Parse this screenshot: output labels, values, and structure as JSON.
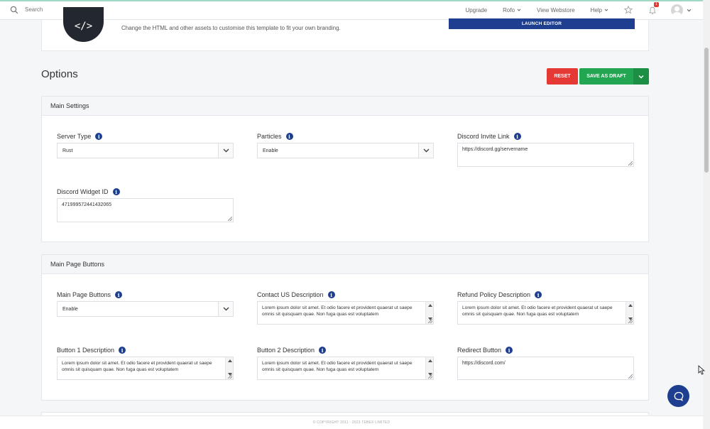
{
  "topnav": {
    "search_placeholder": "Search",
    "upgrade": "Upgrade",
    "account": "Rofo",
    "view_webstore": "View Webstore",
    "help": "Help",
    "notification_count": "1"
  },
  "editor": {
    "description": "Change the HTML and other assets to customise this template to fit your own branding.",
    "launch_label": "LAUNCH EDITOR",
    "logo_glyph": "</>"
  },
  "options": {
    "title": "Options",
    "reset_label": "RESET",
    "draft_label": "SAVE AS DRAFT"
  },
  "main_settings": {
    "heading": "Main Settings",
    "server_type": {
      "label": "Server Type",
      "value": "Rust"
    },
    "particles": {
      "label": "Particles",
      "value": "Enable"
    },
    "discord_invite": {
      "label": "Discord Invite Link",
      "value": "https://discord.gg/servername"
    },
    "discord_widget": {
      "label": "Discord Widget ID",
      "value": "471999572441432065"
    }
  },
  "main_page_buttons": {
    "heading": "Main Page Buttons",
    "buttons": {
      "label": "Main Page Buttons",
      "value": "Enable"
    },
    "contact_us": {
      "label": "Contact US Description",
      "value": "Lorem ipsum dolor sit amet. Et odio facere et provident quaerat ut saepe omnis sit quisquam quae. Non fuga quas est voluptatem"
    },
    "refund_policy": {
      "label": "Refund Policy Description",
      "value": "Lorem ipsum dolor sit amet. Et odio facere et provident quaerat ut saepe omnis sit quisquam quae. Non fuga quas est voluptatem"
    },
    "button1": {
      "label": "Button 1 Description",
      "value": "Lorem ipsum dolor sit amet. Et odio facere et provident quaerat ut saepe omnis sit quisquam quae. Non fuga quas est voluptatem"
    },
    "button2": {
      "label": "Button 2 Description",
      "value": "Lorem ipsum dolor sit amet. Et odio facere et provident quaerat ut saepe omnis sit quisquam quae. Non fuga quas est voluptatem"
    },
    "redirect": {
      "label": "Redirect Button",
      "value": "https://discord.com/"
    }
  },
  "footer": {
    "copyright": "© COPYRIGHT 2011 - 2023 TEBEX LIMITED"
  },
  "icons": {
    "search": "search-icon",
    "star": "star-icon",
    "bell": "bell-icon",
    "chat": "chat-bubble-icon",
    "info": "info-icon",
    "chevron": "chevron-down-icon"
  },
  "colors": {
    "primary": "#1e3f8f",
    "danger": "#e53935",
    "success": "#22a651",
    "success_dark": "#1c8f44"
  }
}
